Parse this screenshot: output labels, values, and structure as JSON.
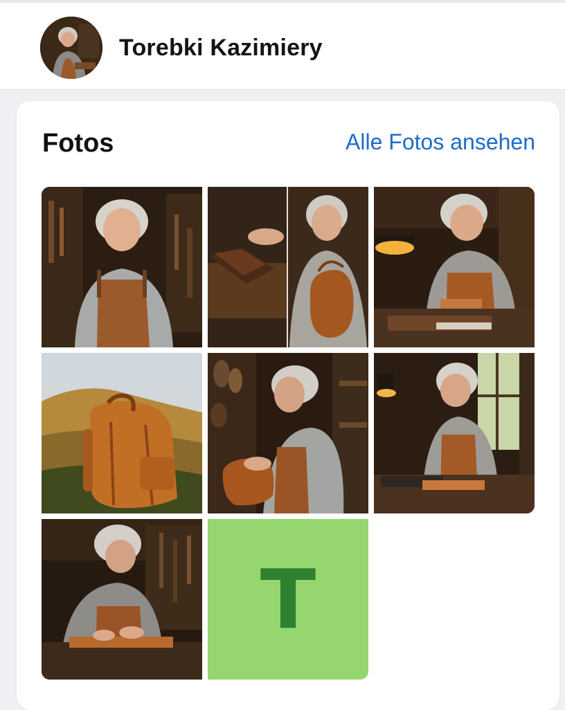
{
  "header": {
    "page_name": "Torebki Kazimiery",
    "avatar_icon": "profile-photo"
  },
  "photos": {
    "title": "Fotos",
    "see_all_label": "Alle Fotos ansehen",
    "letter_tile": {
      "letter": "T",
      "background": "#95d66f",
      "letter_color": "#2f8030"
    }
  },
  "colors": {
    "link": "#1c6ccc",
    "page_bg": "#eef0f4"
  }
}
